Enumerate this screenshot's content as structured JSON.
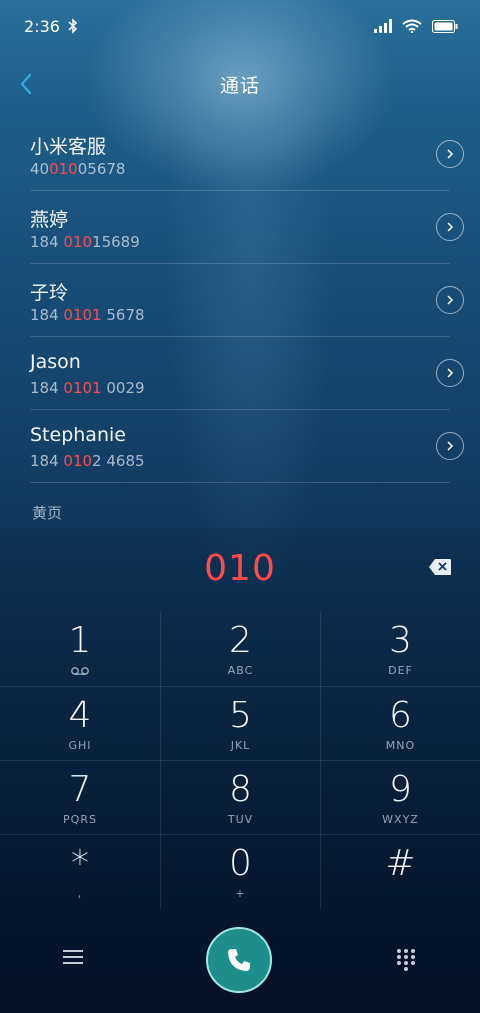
{
  "status": {
    "time": "2:36"
  },
  "header": {
    "title": "通话"
  },
  "contacts": [
    {
      "name": "小米客服",
      "num_pre": "40",
      "num_hl": "010",
      "num_post": "05678"
    },
    {
      "name": "燕婷",
      "num_pre": "184 ",
      "num_hl": "010",
      "num_post": "15689"
    },
    {
      "name": "子玲",
      "num_pre": "184 ",
      "num_hl": "0101",
      "num_post": " 5678"
    },
    {
      "name": "Jason",
      "num_pre": "184 ",
      "num_hl": "0101",
      "num_post": " 0029"
    },
    {
      "name": "Stephanie",
      "num_pre": "184 ",
      "num_hl": "010",
      "num_post": "2 4685"
    }
  ],
  "section": {
    "yellow_pages": "黄页"
  },
  "dialer": {
    "entered": "010"
  },
  "keypad": [
    [
      {
        "digit": "1",
        "sub": ""
      },
      {
        "digit": "2",
        "sub": "ABC"
      },
      {
        "digit": "3",
        "sub": "DEF"
      }
    ],
    [
      {
        "digit": "4",
        "sub": "GHI"
      },
      {
        "digit": "5",
        "sub": "JKL"
      },
      {
        "digit": "6",
        "sub": "MNO"
      }
    ],
    [
      {
        "digit": "7",
        "sub": "PQRS"
      },
      {
        "digit": "8",
        "sub": "TUV"
      },
      {
        "digit": "9",
        "sub": "WXYZ"
      }
    ],
    [
      {
        "digit": "*",
        "sub": ","
      },
      {
        "digit": "0",
        "sub": "+"
      },
      {
        "digit": "#",
        "sub": ""
      }
    ]
  ],
  "colors": {
    "highlight": "#ff4a4a",
    "call_button": "#1d8e8a",
    "back_arrow": "#3aa8e0"
  },
  "icons": [
    "bluetooth-icon",
    "signal-icon",
    "wifi-icon",
    "battery-icon",
    "back-icon",
    "chevron-right-icon",
    "backspace-icon",
    "voicemail-icon",
    "menu-icon",
    "phone-icon",
    "keypad-icon"
  ]
}
